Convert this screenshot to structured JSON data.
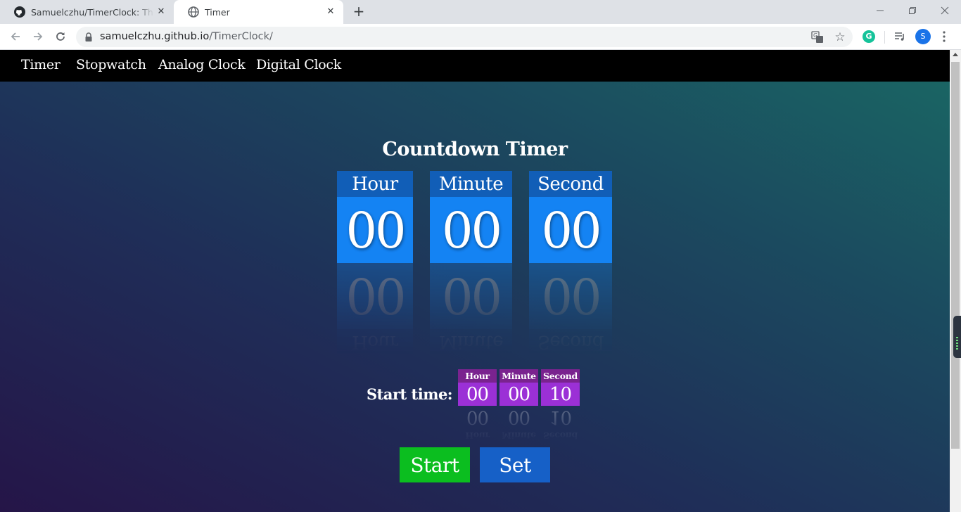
{
  "browser": {
    "tabs": [
      {
        "title": "Samuelczhu/TimerClock: This web",
        "icon": "github-icon",
        "active": false
      },
      {
        "title": "Timer",
        "icon": "globe-icon",
        "active": true
      }
    ],
    "address": {
      "host": "samuelczhu.github.io",
      "path": "/TimerClock/"
    },
    "profile_initial": "S",
    "grammarly_letter": "G"
  },
  "nav": {
    "items": [
      {
        "label": "Timer"
      },
      {
        "label": "Stopwatch"
      },
      {
        "label": "Analog Clock"
      },
      {
        "label": "Digital Clock"
      }
    ]
  },
  "timer": {
    "title": "Countdown Timer",
    "units": [
      {
        "label": "Hour",
        "value": "00"
      },
      {
        "label": "Minute",
        "value": "00"
      },
      {
        "label": "Second",
        "value": "00"
      }
    ]
  },
  "start_time": {
    "label": "Start time:",
    "units": [
      {
        "label": "Hour",
        "value": "00"
      },
      {
        "label": "Minute",
        "value": "00"
      },
      {
        "label": "Second",
        "value": "10"
      }
    ]
  },
  "buttons": {
    "start": "Start",
    "set": "Set"
  },
  "colors": {
    "nav_bg": "#000000",
    "timer_label_bg": "#115eb7",
    "timer_value_bg": "#1483f3",
    "start_label_bg": "#7a238f",
    "start_value_bg": "#9b30d6",
    "start_button": "#0bbe1f",
    "set_button": "#1660c7"
  }
}
